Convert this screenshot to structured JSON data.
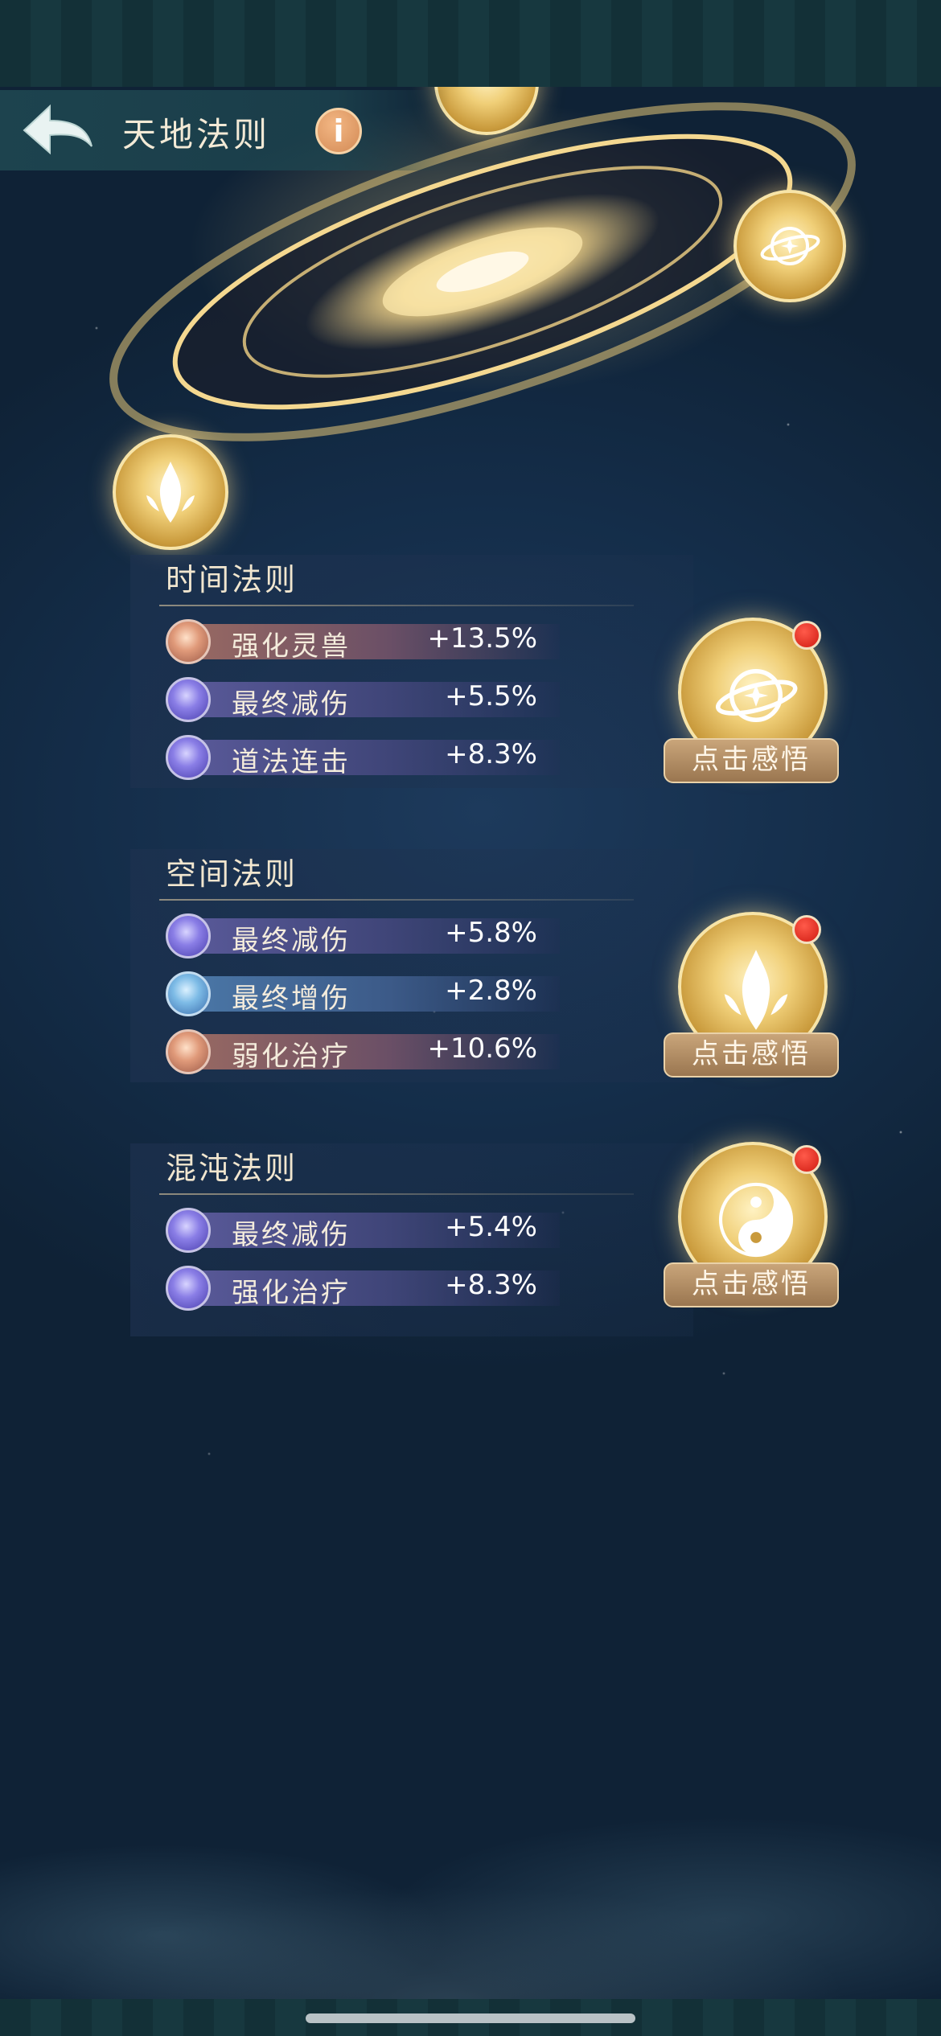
{
  "header": {
    "title": "天地法则",
    "info_label": "i"
  },
  "laws": [
    {
      "title": "时间法则",
      "stats": [
        {
          "name": "强化灵兽",
          "value": "+13.5%"
        },
        {
          "name": "最终减伤",
          "value": "+5.5%"
        },
        {
          "name": "道法连击",
          "value": "+8.3%"
        }
      ],
      "button_label": "点击感悟"
    },
    {
      "title": "空间法则",
      "stats": [
        {
          "name": "最终减伤",
          "value": "+5.8%"
        },
        {
          "name": "最终增伤",
          "value": "+2.8%"
        },
        {
          "name": "弱化治疗",
          "value": "+10.6%"
        }
      ],
      "button_label": "点击感悟"
    },
    {
      "title": "混沌法则",
      "stats": [
        {
          "name": "最终减伤",
          "value": "+5.4%"
        },
        {
          "name": "强化治疗",
          "value": "+8.3%"
        }
      ],
      "button_label": "点击感悟"
    }
  ],
  "icons": {
    "time": "planet-ring-icon",
    "space": "crystal-flame-icon",
    "chaos": "yin-yang-icon"
  },
  "colors": {
    "accent_gold": "#f0cf78",
    "notify_red": "#d01c12"
  }
}
